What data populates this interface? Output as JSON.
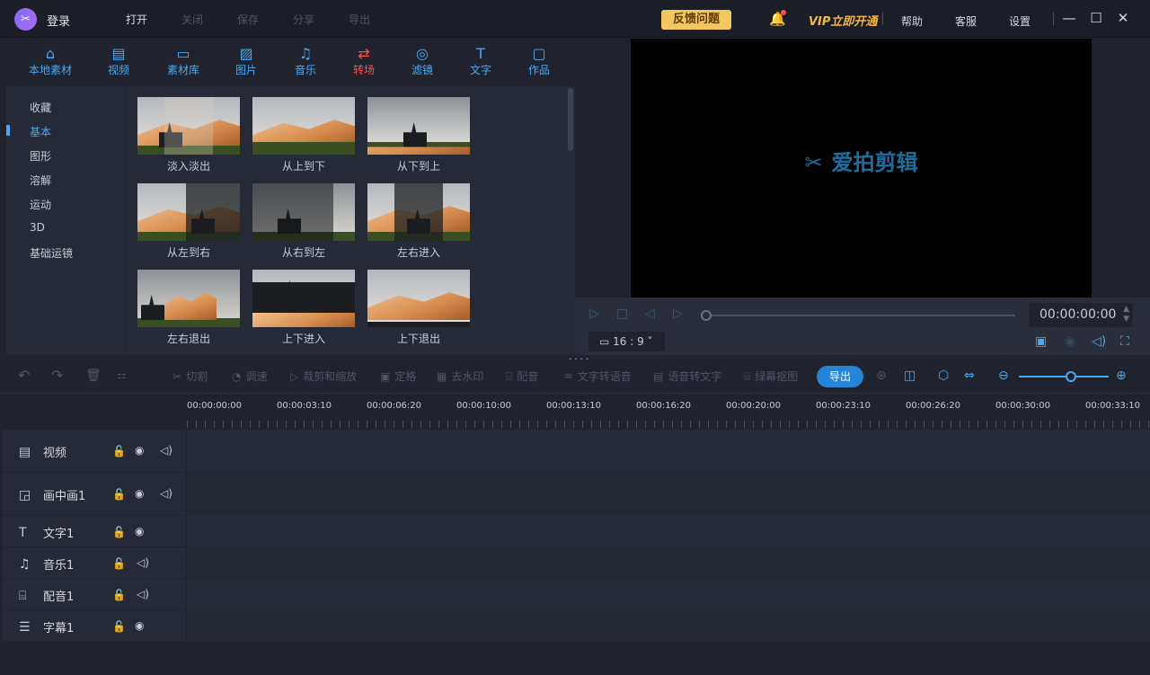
{
  "titlebar": {
    "login": "登录",
    "menu": [
      "打开",
      "关闭",
      "保存",
      "分享",
      "导出"
    ],
    "feedback": "反馈问题",
    "vip": "VIP立即开通",
    "help": "帮助",
    "service": "客服",
    "settings": "设置"
  },
  "tools": [
    {
      "label": "本地素材",
      "icon": "folder-icon"
    },
    {
      "label": "视频",
      "icon": "film-icon"
    },
    {
      "label": "素材库",
      "icon": "library-icon"
    },
    {
      "label": "图片",
      "icon": "image-icon"
    },
    {
      "label": "音乐",
      "icon": "music-icon"
    },
    {
      "label": "转场",
      "icon": "transition-icon"
    },
    {
      "label": "滤镜",
      "icon": "filter-icon"
    },
    {
      "label": "文字",
      "icon": "text-icon"
    },
    {
      "label": "作品",
      "icon": "works-icon"
    }
  ],
  "categories": [
    "收藏",
    "基本",
    "图形",
    "溶解",
    "运动",
    "3D",
    "基础运镜"
  ],
  "transitions": [
    "淡入淡出",
    "从上到下",
    "从下到上",
    "从左到右",
    "从右到左",
    "左右进入",
    "左右退出",
    "上下进入",
    "上下退出"
  ],
  "preview": {
    "brand": "爱拍剪辑",
    "time": "00:00:00:00",
    "ratio": "16 : 9"
  },
  "edit_toolbar": {
    "cut": "切割",
    "speed": "调速",
    "crop": "裁剪和缩放",
    "freeze": "定格",
    "watermark": "去水印",
    "dub": "配音",
    "tts": "文字转语音",
    "stt": "语音转文字",
    "greenscreen": "绿幕抠图",
    "export": "导出"
  },
  "ruler": [
    "00:00:00:00",
    "00:00:03:10",
    "00:00:06:20",
    "00:00:10:00",
    "00:00:13:10",
    "00:00:16:20",
    "00:00:20:00",
    "00:00:23:10",
    "00:00:26:20",
    "00:00:30:00",
    "00:00:33:10"
  ],
  "tracks": [
    {
      "name": "视频",
      "icon": "film-icon"
    },
    {
      "name": "画中画1",
      "icon": "pip-icon"
    },
    {
      "name": "文字1",
      "icon": "text-icon"
    },
    {
      "name": "音乐1",
      "icon": "music-icon"
    },
    {
      "name": "配音1",
      "icon": "microphone-icon"
    },
    {
      "name": "字幕1",
      "icon": "subtitle-icon"
    }
  ],
  "colors": {
    "accent": "#4aa8f0",
    "active_tab": "#ff5050",
    "vip": "#f3b73d",
    "feedback_bg": "#f5c660",
    "export": "#2384d8"
  }
}
